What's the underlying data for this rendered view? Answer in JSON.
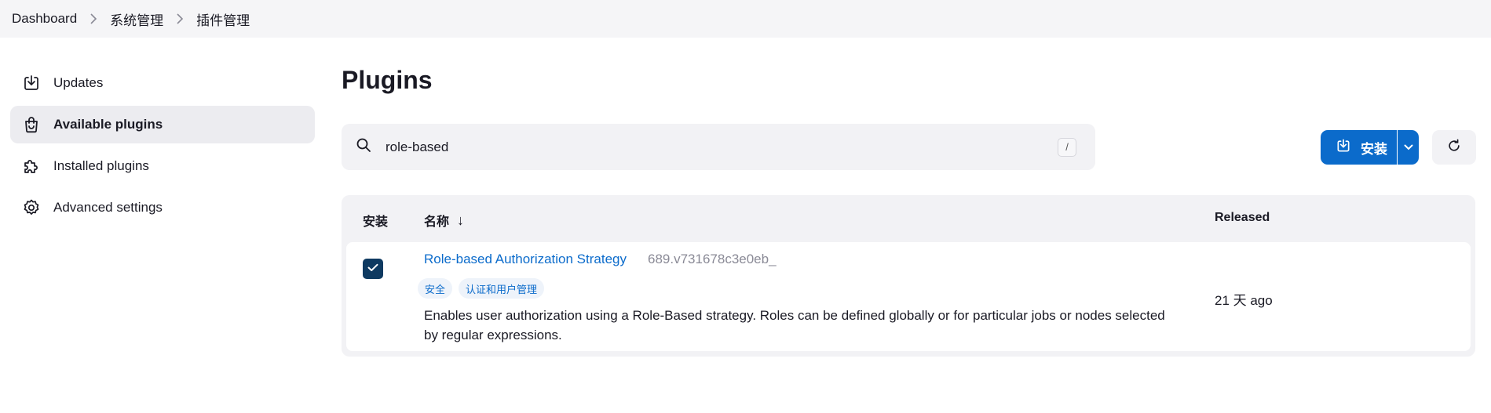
{
  "breadcrumb": {
    "items": [
      "Dashboard",
      "系统管理",
      "插件管理"
    ]
  },
  "sidebar": {
    "items": [
      {
        "label": "Updates",
        "icon": "download-icon",
        "active": false
      },
      {
        "label": "Available plugins",
        "icon": "shopping-bag-icon",
        "active": true
      },
      {
        "label": "Installed plugins",
        "icon": "puzzle-icon",
        "active": false
      },
      {
        "label": "Advanced settings",
        "icon": "gear-icon",
        "active": false
      }
    ]
  },
  "main": {
    "title": "Plugins",
    "search": {
      "value": "role-based",
      "shortcut": "/"
    },
    "install_button": {
      "label": "安装"
    },
    "table": {
      "headers": {
        "install": "安装",
        "name": "名称",
        "sort_arrow": "↓",
        "released": "Released"
      },
      "rows": [
        {
          "checked": true,
          "name": "Role-based Authorization Strategy",
          "version": "689.v731678c3e0eb_",
          "tags": [
            "安全",
            "认证和用户管理"
          ],
          "description": "Enables user authorization using a Role-Based strategy. Roles can be defined globally or for particular jobs or nodes selected by regular expressions.",
          "released": "21 天 ago"
        }
      ]
    }
  },
  "colors": {
    "accent": "#0b6bcb",
    "checkbox": "#0e3a61",
    "surface": "#f2f2f5"
  }
}
